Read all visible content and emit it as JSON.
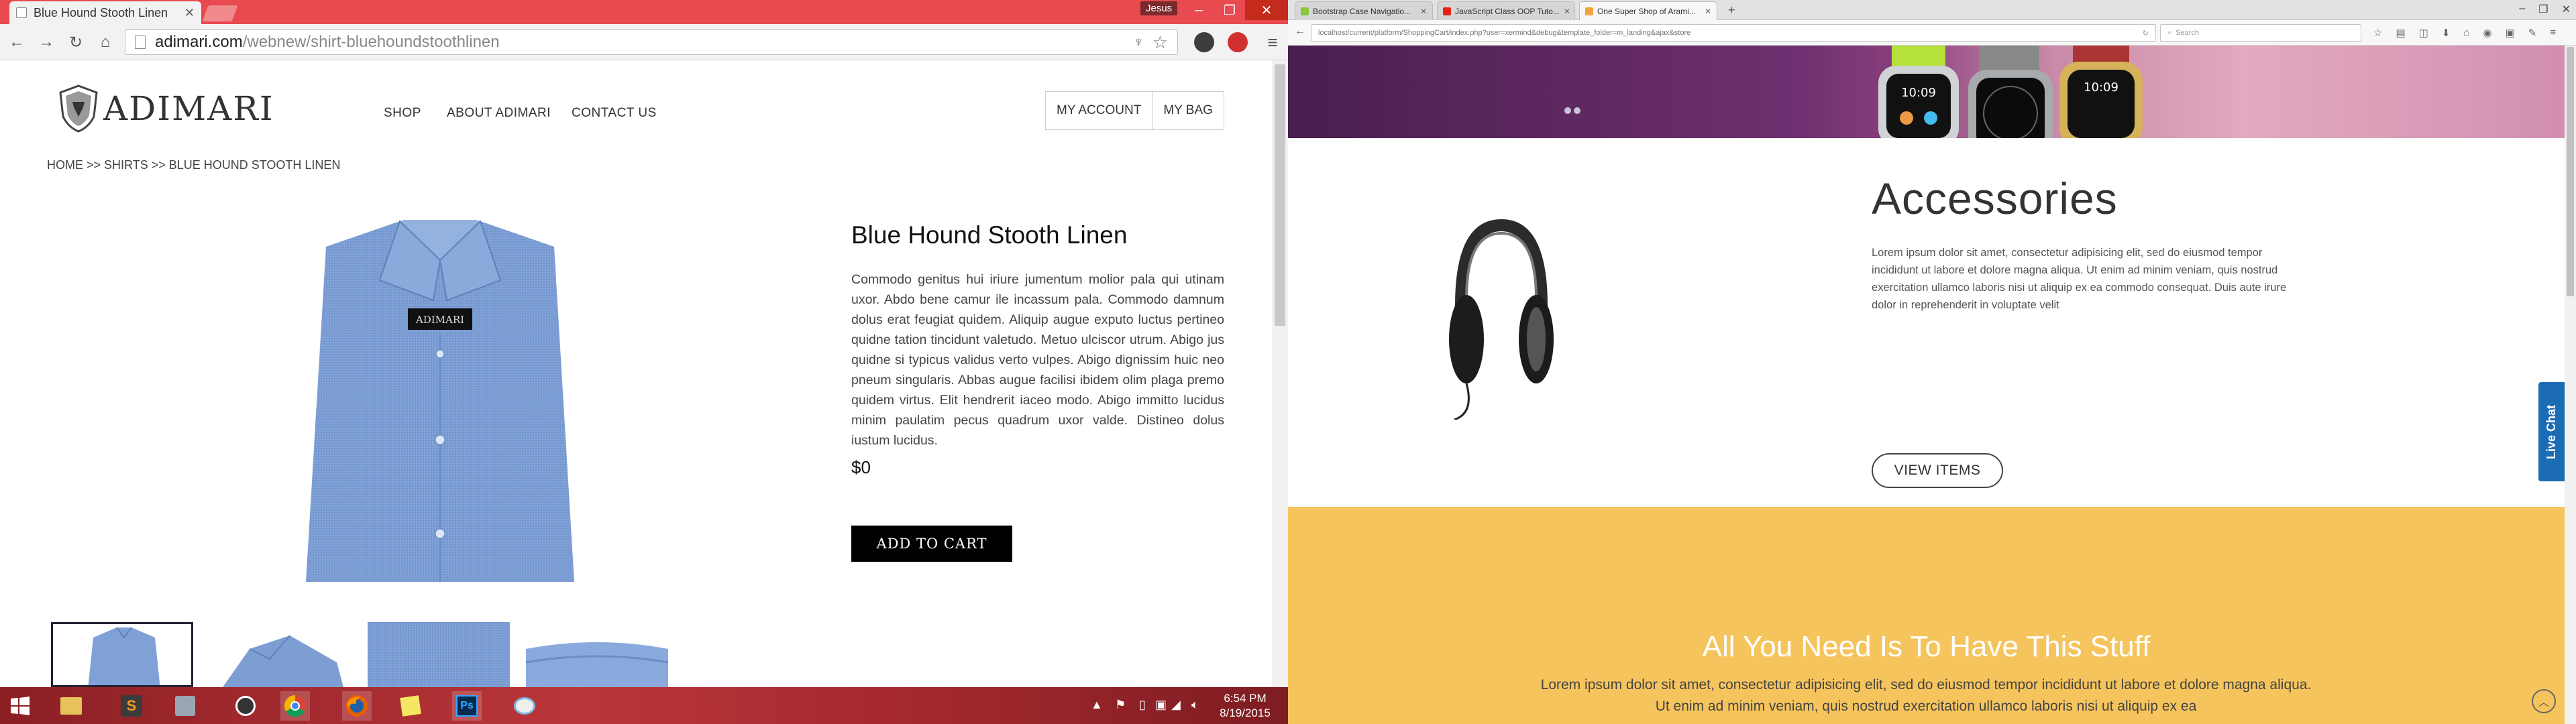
{
  "left_browser": {
    "tab_title": "Blue Hound Stooth Linen",
    "user_name": "Jesus",
    "url_host": "adimari.com",
    "url_path": "/webnew/shirt-bluehoundstoothlinen"
  },
  "site": {
    "logo": "ADIMARI",
    "nav": [
      "SHOP",
      "ABOUT ADIMARI",
      "CONTACT US"
    ],
    "account": [
      "MY ACCOUNT",
      "MY BAG"
    ],
    "breadcrumb": "HOME >> SHIRTS >> BLUE HOUND STOOTH LINEN",
    "product_label": "ADIMARI"
  },
  "product": {
    "title": "Blue Hound Stooth Linen",
    "description": "Commodo genitus hui iriure jumentum molior pala qui utinam uxor. Abdo bene camur ile incassum pala. Commodo damnum dolus erat feugiat quidem. Aliquip augue exputo luctus pertineo quidne tation tincidunt valetudo. Metuo ulciscor utrum. Abigo jus quidne si typicus validus verto vulpes. Abigo dignissim huic neo pneum singularis. Abbas augue facilisi ibidem olim plaga premo quidem virtus. Elit hendrerit iaceo modo. Abigo immitto lucidus minim paulatim pecus quadrum uxor valde. Distineo dolus iustum lucidus.",
    "price": "$0",
    "add_to_cart": "ADD TO CART"
  },
  "taskbar": {
    "time": "6:54 PM",
    "date": "8/19/2015"
  },
  "right_browser": {
    "tabs": [
      {
        "title": "Bootstrap Case Navigatio...",
        "color": "#8cc63e"
      },
      {
        "title": "JavaScript Class OOP Tuto...",
        "color": "#e62117"
      },
      {
        "title": "One Super Shop of Arami...",
        "color": "#f2a33a"
      }
    ],
    "url": "localhost/current/platform/ShoppingCart/index.php?user=xermind&debug&template_folder=m_landing&ajax&store",
    "search_placeholder": "Search"
  },
  "right_page": {
    "accessories_title": "Accessories",
    "accessories_text": "Lorem ipsum dolor sit amet, consectetur adipisicing elit, sed do eiusmod tempor incididunt ut labore et dolore magna aliqua. Ut enim ad minim veniam, quis nostrud exercitation ullamco laboris nisi ut aliquip ex ea commodo consequat. Duis aute irure dolor in reprehenderit in voluptate velit",
    "view_items": "VIEW ITEMS",
    "stuff_title": "All You Need Is To Have This Stuff",
    "stuff_text": "Lorem ipsum dolor sit amet, consectetur adipisicing elit, sed do eiusmod tempor incididunt ut labore et dolore magna aliqua. Ut enim ad minim veniam, quis nostrud exercitation ullamco laboris nisi ut aliquip ex ea",
    "live_chat": "Live Chat",
    "watch_time": "10:09"
  }
}
